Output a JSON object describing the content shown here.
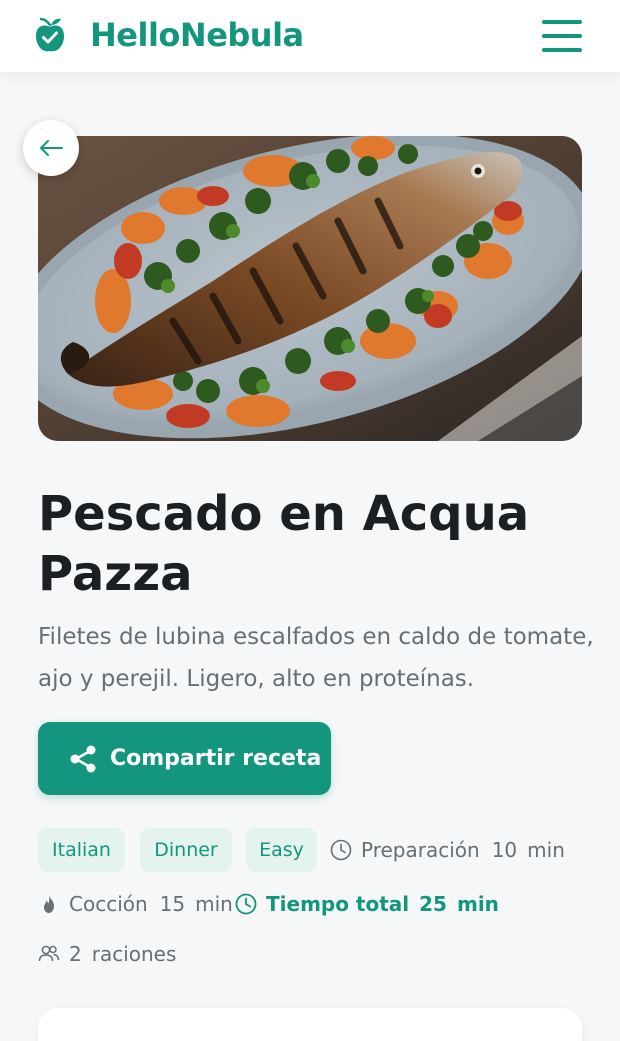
{
  "header": {
    "brand": "HelloNebula",
    "logo_icon": "apple-check-icon",
    "menu_icon": "hamburger-menu-icon"
  },
  "hero": {
    "image": "grilled-fish-plate-photo",
    "back_icon": "arrow-left-icon"
  },
  "recipe": {
    "title": "Pescado en Acqua Pazza",
    "description": "Filetes de lubina escalfados en caldo de tomate, ajo y perejil. Ligero, alto en proteínas.",
    "share_label": "Compartir receta",
    "share_icon": "share-icon"
  },
  "tags": [
    "Italian",
    "Dinner",
    "Easy"
  ],
  "meta": {
    "prep": {
      "label": "Preparación",
      "value": "10",
      "unit": "min",
      "icon": "clock-icon"
    },
    "cook": {
      "label": "Cocción",
      "value": "15",
      "unit": "min",
      "icon": "flame-icon"
    },
    "total": {
      "label": "Tiempo total",
      "value": "25",
      "unit": "min",
      "icon": "clock-icon"
    },
    "servings": {
      "value": "2",
      "label": "raciones",
      "icon": "people-icon"
    }
  },
  "colors": {
    "accent": "#13967d",
    "tag_bg": "#e4f3ee",
    "background": "#f5f7f8",
    "text": "#1b1f22",
    "muted": "#676f75"
  }
}
